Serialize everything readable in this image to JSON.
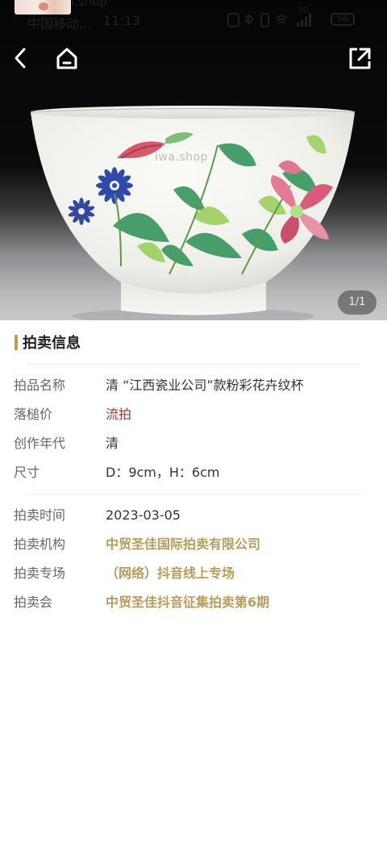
{
  "status_bar": {
    "source_label": "i.shop",
    "carrier": "中国移动...",
    "time": "11:13",
    "network_label": "5G",
    "battery": "56"
  },
  "hero": {
    "watermark": "iwa.shop",
    "image_counter": "1/1"
  },
  "nav": {
    "back_icon": "chevron-left-icon",
    "home_icon": "home-icon",
    "share_icon": "share-icon"
  },
  "section": {
    "title": "拍卖信息"
  },
  "details": [
    {
      "label": "拍品名称",
      "value": "清 “江西瓷业公司”款粉彩花卉纹杯"
    },
    {
      "label": "落槌价",
      "value": "流拍"
    },
    {
      "label": "创作年代",
      "value": "清"
    },
    {
      "label": "尺寸",
      "value": "D：9cm，H：6cm"
    }
  ],
  "auction": [
    {
      "label": "拍卖时间",
      "value": "2023-03-05"
    },
    {
      "label": "拍卖机构",
      "value": "中贸圣佳国际拍卖有限公司"
    },
    {
      "label": "拍卖专场",
      "value": "（网络）抖音线上专场"
    },
    {
      "label": "拍卖会",
      "value": "中贸圣佳抖音征集拍卖第6期"
    }
  ],
  "colors": {
    "accent_gold": "#b89c5f",
    "hammer_price_red": "#9a3a32",
    "label_gray": "#666666"
  }
}
